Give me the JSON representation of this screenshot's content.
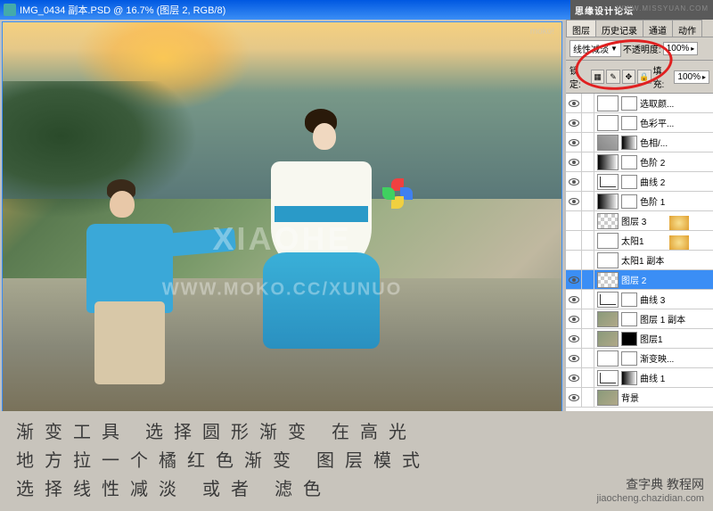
{
  "window": {
    "title": "IMG_0434 副本.PSD @ 16.7% (图层 2, RGB/8)"
  },
  "topbar": {
    "logo": "思缘设计论坛",
    "url": "WWW.MISSYUAN.COM"
  },
  "canvas": {
    "watermark1": "XIAOHE",
    "watermark2": "WWW.MOKO.CC/XUNUO",
    "moko": "moko!"
  },
  "panel": {
    "tabs": [
      "图层",
      "历史记录",
      "通道",
      "动作"
    ],
    "blend_mode": "线性减淡",
    "opacity_label": "不透明度:",
    "opacity_value": "100%",
    "lock_label": "锁定:",
    "fill_label": "填充:",
    "fill_value": "100%"
  },
  "layers": [
    {
      "name": "选取颜...",
      "type": "adj",
      "mask": "white",
      "eye": true
    },
    {
      "name": "色彩平...",
      "type": "adj",
      "mask": "white",
      "eye": true
    },
    {
      "name": "色相/...",
      "type": "hue",
      "mask": "grad",
      "eye": true
    },
    {
      "name": "色阶 2",
      "type": "levels",
      "mask": "white",
      "eye": true
    },
    {
      "name": "曲线 2",
      "type": "curves",
      "mask": "white",
      "eye": true
    },
    {
      "name": "色阶 1",
      "type": "levels",
      "mask": "white",
      "eye": true
    },
    {
      "name": "图层 3",
      "type": "checker",
      "mask": "",
      "eye": false
    },
    {
      "name": "太阳1",
      "type": "sun",
      "mask": "",
      "eye": false
    },
    {
      "name": "太阳1 副本",
      "type": "sun",
      "mask": "",
      "eye": false
    },
    {
      "name": "图层 2",
      "type": "checker",
      "mask": "",
      "eye": true,
      "selected": true
    },
    {
      "name": "曲线 3",
      "type": "curves",
      "mask": "white",
      "eye": true
    },
    {
      "name": "图层 1 副本",
      "type": "img",
      "mask": "white",
      "eye": true
    },
    {
      "name": "图层1",
      "type": "img",
      "mask": "black",
      "eye": true
    },
    {
      "name": "渐变映...",
      "type": "adj",
      "mask": "white",
      "eye": true
    },
    {
      "name": "曲线 1",
      "type": "curves",
      "mask": "grad",
      "eye": true
    },
    {
      "name": "背景",
      "type": "img",
      "mask": "",
      "eye": true
    }
  ],
  "caption": {
    "line1": "渐变工具 选择圆形渐变 在高光",
    "line2": "地方拉一个橘红色渐变 图层模式",
    "line3": "选择线性减淡 或者 滤色"
  },
  "corner": {
    "brand": "查字典 教程网",
    "url": "jiaocheng.chazidian.com"
  }
}
